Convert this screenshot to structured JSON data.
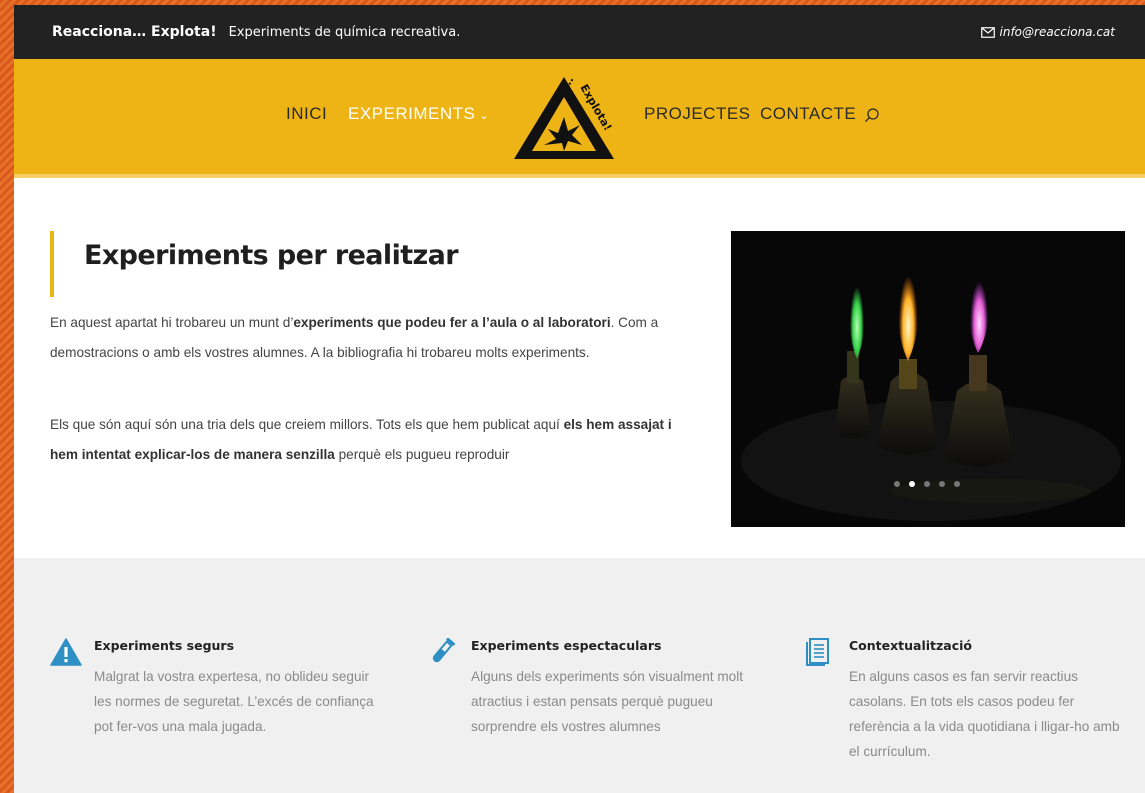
{
  "topbar": {
    "brand": "Reacciona… Explota!",
    "tagline": "Experiments de química recreativa.",
    "email": "info@reacciona.cat"
  },
  "nav": {
    "items": [
      {
        "label": "INICI"
      },
      {
        "label": "EXPERIMENTS",
        "active": true,
        "has_dropdown": true
      },
      {
        "label": "PROJECTES"
      },
      {
        "label": "CONTACTE"
      }
    ],
    "logo_text": "Reacciona...Explota!"
  },
  "intro": {
    "title": "Experiments per realitzar",
    "paragraph1": {
      "part1": "En aquest apartat hi trobareu un munt d’",
      "bold": "experiments que podeu fer a l’aula o al laboratori",
      "part2": ". Com a demostracions o amb els vostres alumnes. A la bibliografia hi trobareu molts experiments."
    },
    "paragraph2": {
      "part1": "Els que són aquí són una tria dels que creiem millors. Tots els que hem publicat aquí ",
      "bold": "els hem assajat i hem intentat explicar-los de manera senzilla",
      "part2": " perquè els pugueu reproduir"
    },
    "slider": {
      "slide_count": 5,
      "active_slide": 2
    }
  },
  "features": [
    {
      "icon": "warning-icon",
      "title": "Experiments segurs",
      "text": "Malgrat la vostra expertesa, no oblideu seguir les normes de seguretat. L’excés de confiança pot fer-vos una mala jugada."
    },
    {
      "icon": "test-tube-icon",
      "title": "Experiments espectaculars",
      "text": "Alguns dels experiments són visualment molt atractius i estan pensats perquè pugueu sorprendre els vostres alumnes"
    },
    {
      "icon": "document-icon",
      "title": "Contextualització",
      "text": "En alguns casos es fan servir reactius casolans. En tots els casos podeu fer referència a la vida quotidiana i lligar-ho amb el currículum."
    }
  ],
  "colors": {
    "header": "#eeb416",
    "topbar": "#222222",
    "icon_blue": "#2e8fc4",
    "accent_border": "#eeb416"
  }
}
